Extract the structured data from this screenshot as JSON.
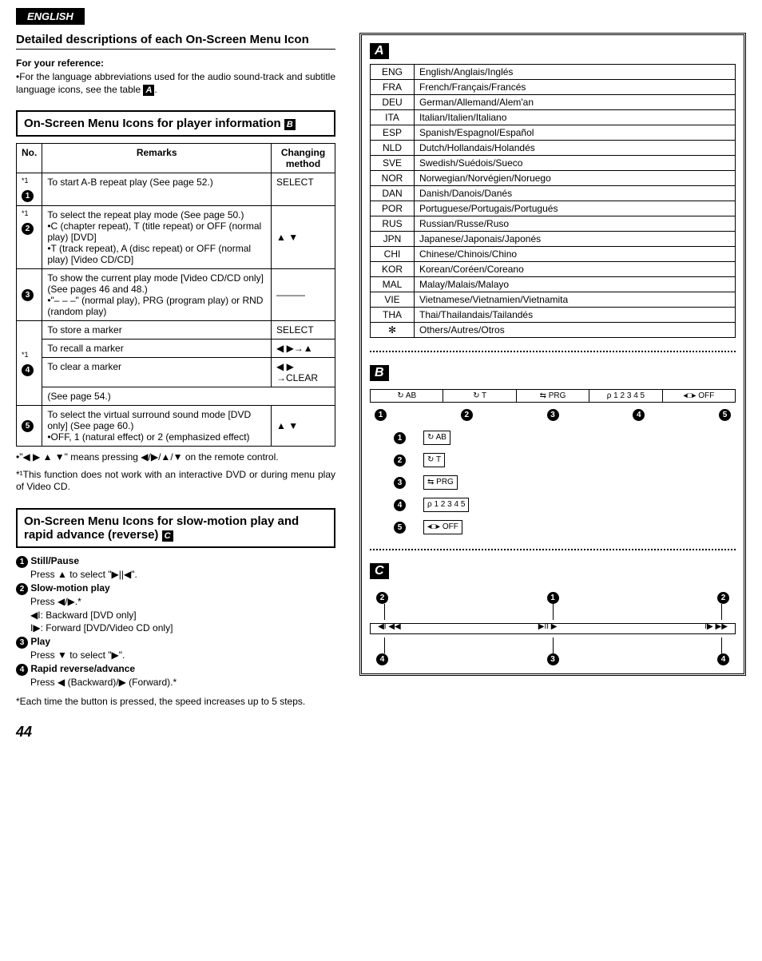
{
  "top_badge": "ENGLISH",
  "main_heading": "Detailed descriptions of each On-Screen Menu Icon",
  "reference": {
    "heading": "For your reference:",
    "text_prefix": "•For the language abbreviations used for the audio sound-track and subtitle language icons, see the table ",
    "badge": "A",
    "text_suffix": "."
  },
  "player_info_title_prefix": "On-Screen Menu Icons for player information ",
  "player_info_badge": "B",
  "info_table": {
    "headers": {
      "no": "No.",
      "remarks": "Remarks",
      "method": "Changing method"
    },
    "rows": [
      {
        "no": "1",
        "sup": "*1",
        "remarks": "To start A-B repeat play (See page 52.)",
        "method": "SELECT"
      },
      {
        "no": "2",
        "sup": "*1",
        "remarks": "To select the repeat play mode (See page 50.)\n•C (chapter repeat), T (title repeat) or OFF (normal play) [DVD]\n•T (track repeat), A (disc repeat) or OFF (normal play) [Video CD/CD]",
        "method": "▲ ▼"
      },
      {
        "no": "3",
        "sup": "",
        "remarks": "To show the current play mode [Video CD/CD only]\n(See pages 46 and 48.)\n•\"– – –\" (normal play), PRG (program play) or RND (random play)",
        "method": "———"
      },
      {
        "no": "4a",
        "sup": "*1",
        "no_disp": "4",
        "remarks": "To store a marker",
        "method": "SELECT"
      },
      {
        "no": "4b",
        "remarks": "To recall a marker",
        "method": "◀ ▶→▲"
      },
      {
        "no": "4c",
        "remarks": "To clear a marker",
        "method": "◀ ▶\n→CLEAR"
      },
      {
        "no": "4d",
        "remarks": "(See page 54.)",
        "method": ""
      },
      {
        "no": "5",
        "sup": "",
        "remarks": "To select the virtual surround sound mode [DVD only] (See page 60.)\n•OFF, 1 (natural effect) or 2 (emphasized effect)",
        "method": "▲ ▼"
      }
    ]
  },
  "notes": {
    "n1": "•\"◀ ▶ ▲ ▼\" means pressing ◀/▶/▲/▼ on the remote control.",
    "n2": "*¹This function does not work with an interactive DVD or during menu play of Video CD."
  },
  "slow_title_prefix": "On-Screen Menu Icons for slow-motion play and rapid advance (reverse) ",
  "slow_badge": "C",
  "slow_items": [
    {
      "num": "1",
      "title": "Still/Pause",
      "lines": [
        "Press ▲ to select \"▶||◀\"."
      ]
    },
    {
      "num": "2",
      "title": "Slow-motion play",
      "lines": [
        "Press ◀/▶.*",
        "◀I: Backward [DVD only]",
        "I▶: Forward [DVD/Video CD only]"
      ]
    },
    {
      "num": "3",
      "title": "Play",
      "lines": [
        "Press ▼ to select \"▶\"."
      ]
    },
    {
      "num": "4",
      "title": "Rapid reverse/advance",
      "lines": [
        "Press ◀ (Backward)/▶ (Forward).*"
      ]
    }
  ],
  "slow_footnote": "*Each time the button is pressed, the speed increases up to 5 steps.",
  "page_number": "44",
  "sidebar": {
    "a_label": "A",
    "b_label": "B",
    "c_label": "C",
    "lang_table": [
      {
        "code": "ENG",
        "name": "English/Anglais/Inglés"
      },
      {
        "code": "FRA",
        "name": "French/Français/Francés"
      },
      {
        "code": "DEU",
        "name": "German/Allemand/Alem'an"
      },
      {
        "code": "ITA",
        "name": "Italian/Italien/Italiano"
      },
      {
        "code": "ESP",
        "name": "Spanish/Espagnol/Español"
      },
      {
        "code": "NLD",
        "name": "Dutch/Hollandais/Holandés"
      },
      {
        "code": "SVE",
        "name": "Swedish/Suédois/Sueco"
      },
      {
        "code": "NOR",
        "name": "Norwegian/Norvégien/Noruego"
      },
      {
        "code": "DAN",
        "name": "Danish/Danois/Danés"
      },
      {
        "code": "POR",
        "name": "Portuguese/Portugais/Portugués"
      },
      {
        "code": "RUS",
        "name": "Russian/Russe/Ruso"
      },
      {
        "code": "JPN",
        "name": "Japanese/Japonais/Japonés"
      },
      {
        "code": "CHI",
        "name": "Chinese/Chinois/Chino"
      },
      {
        "code": "KOR",
        "name": "Korean/Coréen/Coreano"
      },
      {
        "code": "MAL",
        "name": "Malay/Malais/Malayo"
      },
      {
        "code": "VIE",
        "name": "Vietnamese/Vietnamien/Vietnamita"
      },
      {
        "code": "THA",
        "name": "Thai/Thailandais/Tailandés"
      },
      {
        "code": "✻",
        "name": "Others/Autres/Otros"
      }
    ],
    "b_strip": [
      "↻ AB",
      "↻ T",
      "⇆ PRG",
      "ρ 1 2 3 4 5",
      "◂□▸ OFF"
    ],
    "b_legend": [
      {
        "num": "1",
        "icon": "↻ AB"
      },
      {
        "num": "2",
        "icon": "↻ T"
      },
      {
        "num": "3",
        "icon": "⇆ PRG"
      },
      {
        "num": "4",
        "icon": "ρ 1 2 3 4 5"
      },
      {
        "num": "5",
        "icon": "◂□▸ OFF"
      }
    ],
    "c_nums_top": [
      "2",
      "1",
      "2"
    ],
    "c_nums_bottom": [
      "4",
      "3",
      "4"
    ],
    "c_track_marks": {
      "left": "◀I   ◀◀",
      "mid": "▶II   ▶",
      "right": "I▶   ▶▶"
    }
  }
}
